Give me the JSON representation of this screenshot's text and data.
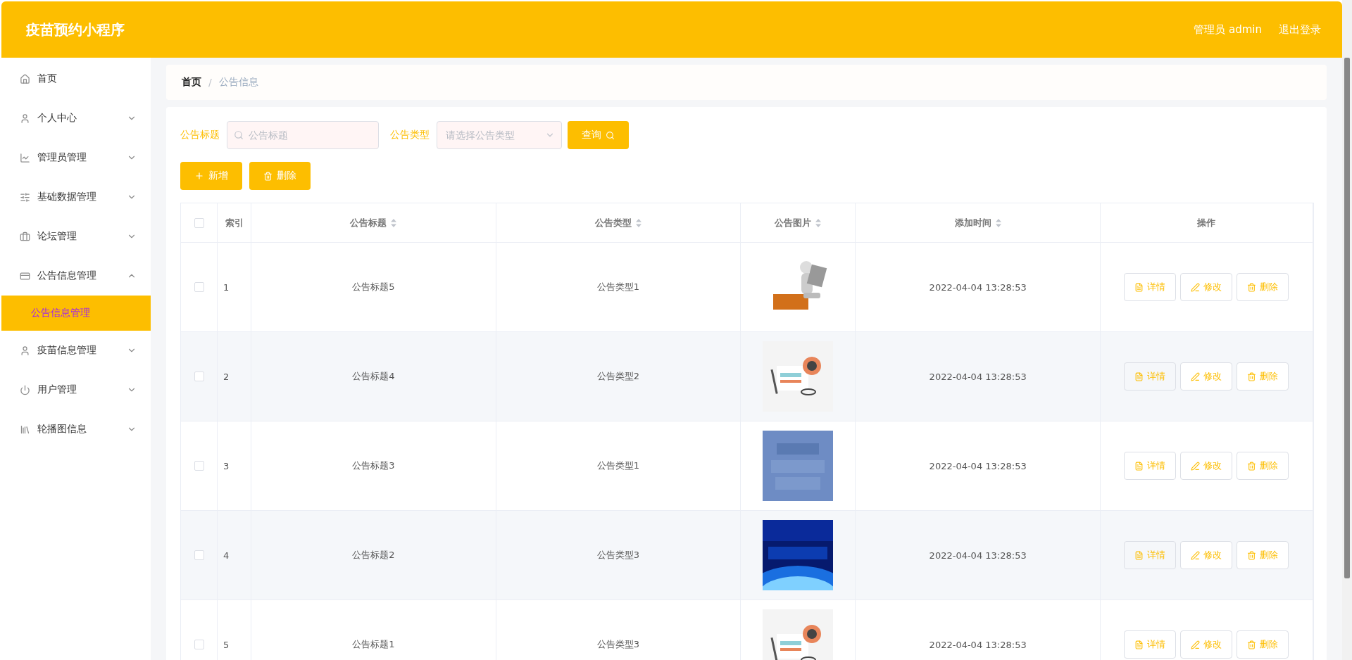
{
  "header": {
    "title": "疫苗预约小程序",
    "user": "管理员 admin",
    "logout": "退出登录"
  },
  "sidebar": {
    "items": [
      {
        "label": "首页",
        "kind": "link"
      },
      {
        "label": "个人中心",
        "kind": "menu",
        "expanded": false
      },
      {
        "label": "管理员管理",
        "kind": "menu",
        "expanded": false
      },
      {
        "label": "基础数据管理",
        "kind": "menu",
        "expanded": false
      },
      {
        "label": "论坛管理",
        "kind": "menu",
        "expanded": false
      },
      {
        "label": "公告信息管理",
        "kind": "menu",
        "expanded": true,
        "children": [
          {
            "label": "公告信息管理",
            "selected": true
          }
        ]
      },
      {
        "label": "疫苗信息管理",
        "kind": "menu",
        "expanded": false
      },
      {
        "label": "用户管理",
        "kind": "menu",
        "expanded": false
      },
      {
        "label": "轮播图信息",
        "kind": "menu",
        "expanded": false
      }
    ]
  },
  "breadcrumb": {
    "separator": "/",
    "items": [
      "首页",
      "公告信息"
    ]
  },
  "filters": {
    "title_label": "公告标题",
    "title_placeholder": "公告标题",
    "type_label": "公告类型",
    "type_placeholder": "请选择公告类型",
    "search_button": "查询"
  },
  "actions": [
    "新增",
    "删除"
  ],
  "table": {
    "all_checked": false,
    "columns": [
      "索引",
      "公告标题",
      "公告类型",
      "公告图片",
      "添加时间",
      "操作"
    ],
    "rows": [
      {
        "checked": false,
        "index": "1",
        "title": "公告标题5",
        "type": "公告类型1",
        "time": "2022-04-04 13:28:53",
        "buttons": [
          "详情",
          "修改",
          "删除"
        ]
      },
      {
        "checked": false,
        "index": "2",
        "title": "公告标题4",
        "type": "公告类型2",
        "time": "2022-04-04 13:28:53",
        "buttons": [
          "详情",
          "修改",
          "删除"
        ]
      },
      {
        "checked": false,
        "index": "3",
        "title": "公告标题3",
        "type": "公告类型1",
        "time": "2022-04-04 13:28:53",
        "buttons": [
          "详情",
          "修改",
          "删除"
        ]
      },
      {
        "checked": false,
        "index": "4",
        "title": "公告标题2",
        "type": "公告类型3",
        "time": "2022-04-04 13:28:53",
        "buttons": [
          "详情",
          "修改",
          "删除"
        ]
      },
      {
        "checked": false,
        "index": "5",
        "title": "公告标题1",
        "type": "公告类型3",
        "time": "2022-04-04 13:28:53",
        "buttons": [
          "详情",
          "修改",
          "删除"
        ]
      }
    ]
  }
}
